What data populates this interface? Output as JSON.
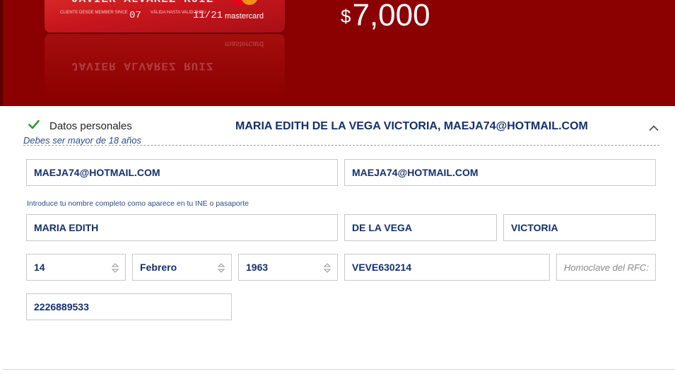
{
  "hero": {
    "amount_currency": "$",
    "amount_value": "7,000",
    "card": {
      "holder_name": "JAVIER ALVAREZ RUIZ",
      "member_since_label": "CLIENTE DESDE MEMBER SINCE",
      "member_since": "07",
      "valid_thru_label": "VÁLIDA HASTA VALID THRU",
      "valid_thru": "11/21",
      "brand": "mastercard"
    },
    "background_color": "#8b0000"
  },
  "section": {
    "title": "Datos personales",
    "subtitle": "Debes ser mayor de 18 años",
    "summary": "MARIA EDITH DE LA VEGA VICTORIA, MAEJA74@HOTMAIL.COM",
    "status_icon": "check-icon",
    "toggle_icon": "chevron-up-icon"
  },
  "form": {
    "email": "MAEJA74@HOTMAIL.COM",
    "email_confirm": "MAEJA74@HOTMAIL.COM",
    "name_hint": "Introduce tu nombre completo como aparece en tu INE o pasaporte",
    "first_names": "MARIA EDITH",
    "last_name_1": "DE LA VEGA",
    "last_name_2": "VICTORIA",
    "birth_day": "14",
    "birth_month": "Febrero",
    "birth_year": "1963",
    "rfc": "VEVE630214",
    "homoclave_placeholder": "Homoclave del RFC:",
    "phone": "2226889533"
  },
  "colors": {
    "accent_text": "#13306e",
    "check_green": "#2e9c2e"
  }
}
